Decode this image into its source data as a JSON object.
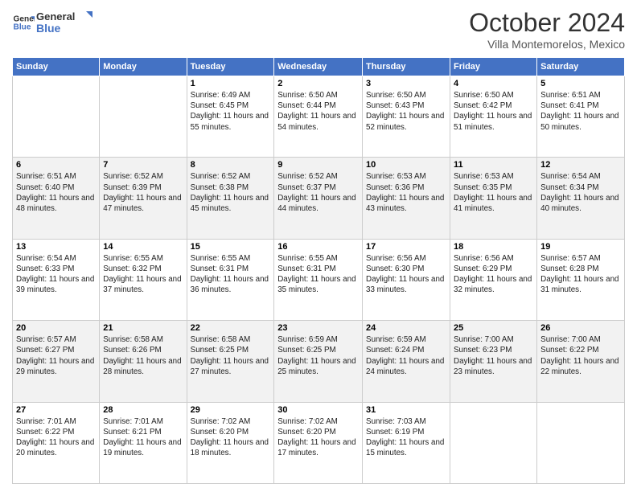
{
  "header": {
    "logo_line1": "General",
    "logo_line2": "Blue",
    "month": "October 2024",
    "location": "Villa Montemorelos, Mexico"
  },
  "weekdays": [
    "Sunday",
    "Monday",
    "Tuesday",
    "Wednesday",
    "Thursday",
    "Friday",
    "Saturday"
  ],
  "weeks": [
    [
      {
        "day": "",
        "info": ""
      },
      {
        "day": "",
        "info": ""
      },
      {
        "day": "1",
        "info": "Sunrise: 6:49 AM\nSunset: 6:45 PM\nDaylight: 11 hours and 55 minutes."
      },
      {
        "day": "2",
        "info": "Sunrise: 6:50 AM\nSunset: 6:44 PM\nDaylight: 11 hours and 54 minutes."
      },
      {
        "day": "3",
        "info": "Sunrise: 6:50 AM\nSunset: 6:43 PM\nDaylight: 11 hours and 52 minutes."
      },
      {
        "day": "4",
        "info": "Sunrise: 6:50 AM\nSunset: 6:42 PM\nDaylight: 11 hours and 51 minutes."
      },
      {
        "day": "5",
        "info": "Sunrise: 6:51 AM\nSunset: 6:41 PM\nDaylight: 11 hours and 50 minutes."
      }
    ],
    [
      {
        "day": "6",
        "info": "Sunrise: 6:51 AM\nSunset: 6:40 PM\nDaylight: 11 hours and 48 minutes."
      },
      {
        "day": "7",
        "info": "Sunrise: 6:52 AM\nSunset: 6:39 PM\nDaylight: 11 hours and 47 minutes."
      },
      {
        "day": "8",
        "info": "Sunrise: 6:52 AM\nSunset: 6:38 PM\nDaylight: 11 hours and 45 minutes."
      },
      {
        "day": "9",
        "info": "Sunrise: 6:52 AM\nSunset: 6:37 PM\nDaylight: 11 hours and 44 minutes."
      },
      {
        "day": "10",
        "info": "Sunrise: 6:53 AM\nSunset: 6:36 PM\nDaylight: 11 hours and 43 minutes."
      },
      {
        "day": "11",
        "info": "Sunrise: 6:53 AM\nSunset: 6:35 PM\nDaylight: 11 hours and 41 minutes."
      },
      {
        "day": "12",
        "info": "Sunrise: 6:54 AM\nSunset: 6:34 PM\nDaylight: 11 hours and 40 minutes."
      }
    ],
    [
      {
        "day": "13",
        "info": "Sunrise: 6:54 AM\nSunset: 6:33 PM\nDaylight: 11 hours and 39 minutes."
      },
      {
        "day": "14",
        "info": "Sunrise: 6:55 AM\nSunset: 6:32 PM\nDaylight: 11 hours and 37 minutes."
      },
      {
        "day": "15",
        "info": "Sunrise: 6:55 AM\nSunset: 6:31 PM\nDaylight: 11 hours and 36 minutes."
      },
      {
        "day": "16",
        "info": "Sunrise: 6:55 AM\nSunset: 6:31 PM\nDaylight: 11 hours and 35 minutes."
      },
      {
        "day": "17",
        "info": "Sunrise: 6:56 AM\nSunset: 6:30 PM\nDaylight: 11 hours and 33 minutes."
      },
      {
        "day": "18",
        "info": "Sunrise: 6:56 AM\nSunset: 6:29 PM\nDaylight: 11 hours and 32 minutes."
      },
      {
        "day": "19",
        "info": "Sunrise: 6:57 AM\nSunset: 6:28 PM\nDaylight: 11 hours and 31 minutes."
      }
    ],
    [
      {
        "day": "20",
        "info": "Sunrise: 6:57 AM\nSunset: 6:27 PM\nDaylight: 11 hours and 29 minutes."
      },
      {
        "day": "21",
        "info": "Sunrise: 6:58 AM\nSunset: 6:26 PM\nDaylight: 11 hours and 28 minutes."
      },
      {
        "day": "22",
        "info": "Sunrise: 6:58 AM\nSunset: 6:25 PM\nDaylight: 11 hours and 27 minutes."
      },
      {
        "day": "23",
        "info": "Sunrise: 6:59 AM\nSunset: 6:25 PM\nDaylight: 11 hours and 25 minutes."
      },
      {
        "day": "24",
        "info": "Sunrise: 6:59 AM\nSunset: 6:24 PM\nDaylight: 11 hours and 24 minutes."
      },
      {
        "day": "25",
        "info": "Sunrise: 7:00 AM\nSunset: 6:23 PM\nDaylight: 11 hours and 23 minutes."
      },
      {
        "day": "26",
        "info": "Sunrise: 7:00 AM\nSunset: 6:22 PM\nDaylight: 11 hours and 22 minutes."
      }
    ],
    [
      {
        "day": "27",
        "info": "Sunrise: 7:01 AM\nSunset: 6:22 PM\nDaylight: 11 hours and 20 minutes."
      },
      {
        "day": "28",
        "info": "Sunrise: 7:01 AM\nSunset: 6:21 PM\nDaylight: 11 hours and 19 minutes."
      },
      {
        "day": "29",
        "info": "Sunrise: 7:02 AM\nSunset: 6:20 PM\nDaylight: 11 hours and 18 minutes."
      },
      {
        "day": "30",
        "info": "Sunrise: 7:02 AM\nSunset: 6:20 PM\nDaylight: 11 hours and 17 minutes."
      },
      {
        "day": "31",
        "info": "Sunrise: 7:03 AM\nSunset: 6:19 PM\nDaylight: 11 hours and 15 minutes."
      },
      {
        "day": "",
        "info": ""
      },
      {
        "day": "",
        "info": ""
      }
    ]
  ]
}
